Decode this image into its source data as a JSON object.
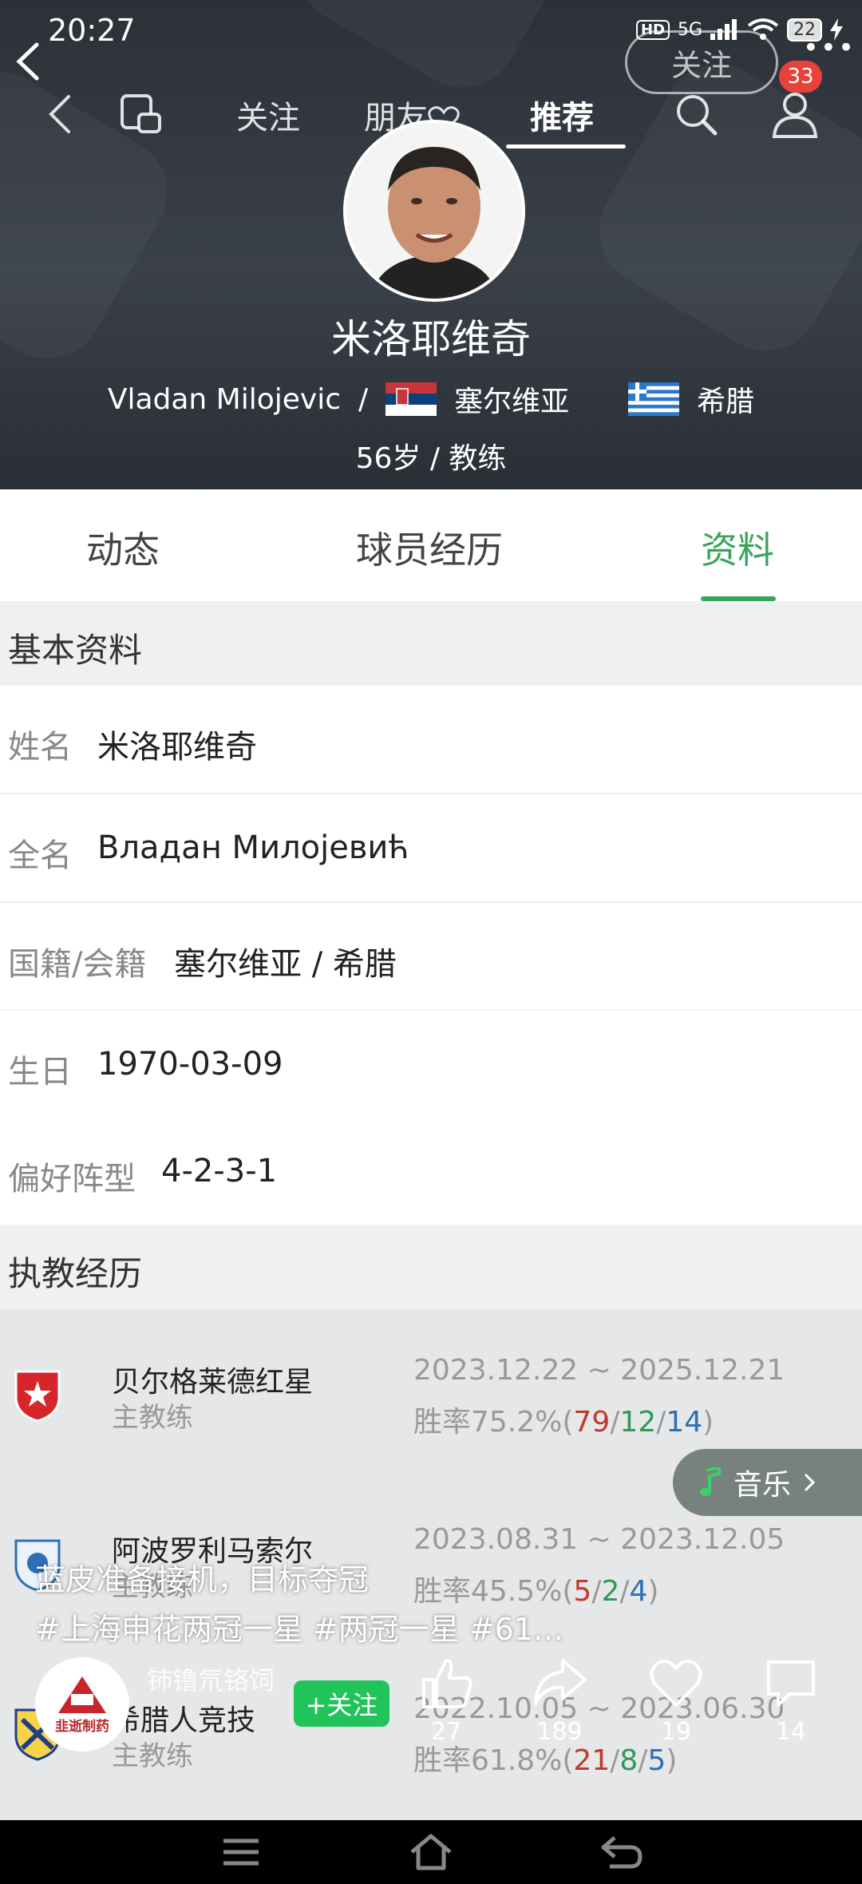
{
  "status_bar": {
    "time": "20:27",
    "network": "5G",
    "hd": "HD",
    "battery": "22"
  },
  "overlay": {
    "follow_label": "关注",
    "notification_badge": "33"
  },
  "top_nav": {
    "tabs": [
      "关注",
      "朋友",
      "推荐"
    ],
    "active_index": 2
  },
  "profile": {
    "name_cn": "米洛耶维奇",
    "name_en": "Vladan Milojevic",
    "separator": "/",
    "nationality_1": "塞尔维亚",
    "nationality_2": "希腊",
    "age_role": "56岁 / 教练"
  },
  "content_tabs": {
    "items": [
      "动态",
      "球员经历",
      "资料"
    ],
    "active_index": 2
  },
  "basic_info": {
    "title": "基本资料",
    "rows": [
      {
        "label": "姓名",
        "value": "米洛耶维奇"
      },
      {
        "label": "全名",
        "value": "Владан Милојевић"
      },
      {
        "label": "国籍/会籍",
        "value": "塞尔维亚 / 希腊"
      },
      {
        "label": "生日",
        "value": "1970-03-09"
      },
      {
        "label": "偏好阵型",
        "value": "4-2-3-1"
      }
    ]
  },
  "coaching": {
    "title": "执教经历",
    "entries": [
      {
        "club": "贝尔格莱德红星",
        "role": "主教练",
        "dates": "2023.12.22 ~ 2025.12.21",
        "rate_prefix": "胜率75.2%(",
        "w": "79",
        "d": "12",
        "l": "14",
        "rate_suffix": ")"
      },
      {
        "club": "阿波罗利马索尔",
        "role": "主教练",
        "dates": "2023.08.31 ~ 2023.12.05",
        "rate_prefix": "胜率45.5%(",
        "w": "5",
        "d": "2",
        "l": "4",
        "rate_suffix": ")"
      },
      {
        "club": "希腊人竞技",
        "role": "主教练",
        "dates": "2022.10.05 ~ 2023.06.30",
        "rate_prefix": "胜率61.8%(",
        "w": "21",
        "d": "8",
        "l": "5",
        "rate_suffix": ")"
      }
    ]
  },
  "video": {
    "music_label": "音乐",
    "caption_line1": "蓝皮准备接机，目标夺冠",
    "caption_line2": "#上海申花两冠一星 #两冠一星 #61…",
    "author_name": "铈镥氘铬饲",
    "author_brand": "韭逝制药",
    "follow_button": "+关注",
    "actions": {
      "likes": "27",
      "shares": "189",
      "favorites": "19",
      "comments": "14"
    }
  }
}
